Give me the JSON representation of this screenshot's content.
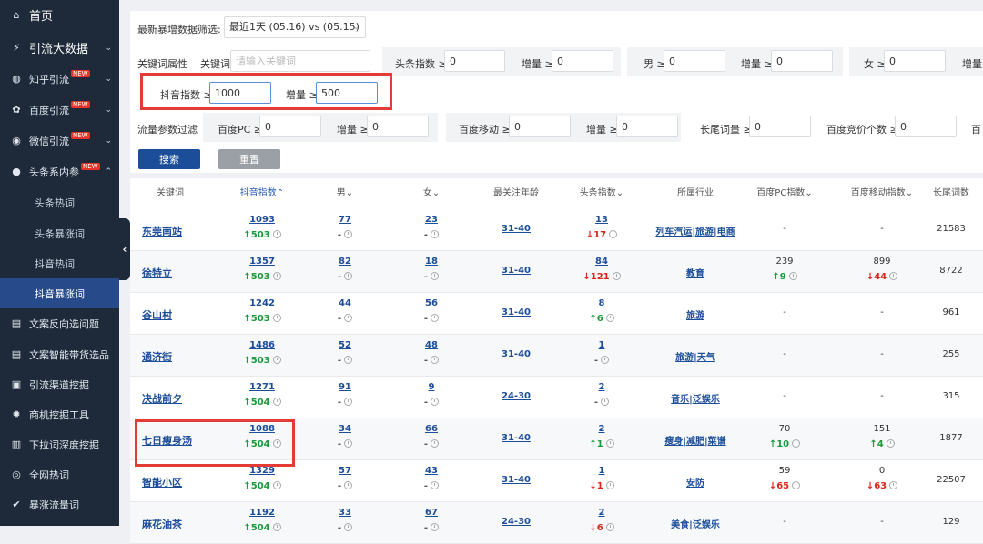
{
  "sidebar": {
    "items": [
      {
        "label": "首页",
        "icon": "home-icon",
        "glyph": "⌂"
      },
      {
        "label": "引流大数据",
        "icon": "pulse-icon",
        "glyph": "⚡"
      },
      {
        "label": "知乎引流",
        "icon": "zhihu-icon",
        "glyph": "◍",
        "badge": "NEW"
      },
      {
        "label": "百度引流",
        "icon": "paw-icon",
        "glyph": "✿",
        "badge": "NEW"
      },
      {
        "label": "微信引流",
        "icon": "wechat-icon",
        "glyph": "◉",
        "badge": "NEW"
      },
      {
        "label": "头条系内参",
        "icon": "chat-icon",
        "glyph": "●",
        "badge": "NEW"
      },
      {
        "label": "头条热词"
      },
      {
        "label": "头条暴涨词"
      },
      {
        "label": "抖音热词"
      },
      {
        "label": "抖音暴涨词"
      },
      {
        "label": "文案反向选问题",
        "icon": "doc-icon",
        "glyph": "▤"
      },
      {
        "label": "文案智能带货选品",
        "icon": "doc-icon",
        "glyph": "▤"
      },
      {
        "label": "引流渠道挖掘",
        "icon": "board-icon",
        "glyph": "▣"
      },
      {
        "label": "商机挖掘工具",
        "icon": "gear-icon",
        "glyph": "✹"
      },
      {
        "label": "下拉词深度挖掘",
        "icon": "dropdown-icon",
        "glyph": "▥"
      },
      {
        "label": "全网热词",
        "icon": "globe-icon",
        "glyph": "◎"
      },
      {
        "label": "暴涨流量词",
        "icon": "check-icon",
        "glyph": "✔"
      }
    ],
    "collapse_glyph": "‹"
  },
  "filters": {
    "date_label": "最新暴增数据筛选:",
    "date_value": "最近1天 (05.16) vs (05.15)",
    "kw_attr_label": "关键词属性",
    "kw_label": "关键词",
    "kw_placeholder": "请输入关键词",
    "toutiao_label": "头条指数 ≥",
    "toutiao_value": "0",
    "inc1_label": "增量 ≥",
    "inc1_value": "0",
    "male_label": "男 ≥",
    "male_value": "0",
    "inc2_label": "增量 ≥",
    "inc2_value": "0",
    "female_label": "女 ≥",
    "female_value": "0",
    "inc3_label": "增量",
    "douyin_label": "抖音指数 ≥",
    "douyin_value": "1000",
    "douyin_inc_label": "增量 ≥",
    "douyin_inc_value": "500",
    "flow_label": "流量参数过滤",
    "baidu_pc_label": "百度PC ≥",
    "baidu_pc_value": "0",
    "inc4_label": "增量 ≥",
    "inc4_value": "0",
    "baidu_mobile_label": "百度移动 ≥",
    "baidu_mobile_value": "0",
    "inc5_label": "增量 ≥",
    "inc5_value": "0",
    "longtail_label": "长尾词量 ≥",
    "longtail_value": "0",
    "bid_label": "百度竞价个数 ≥",
    "bid_value": "0",
    "trailing_label": "百",
    "search_btn": "搜索",
    "reset_btn": "重置"
  },
  "table": {
    "headers": [
      "关键词",
      "抖音指数⌃",
      "男⌄",
      "女⌄",
      "最关注年龄",
      "头条指数⌄",
      "所属行业",
      "百度PC指数⌄",
      "百度移动指数⌄",
      "长尾词数"
    ],
    "rows": [
      {
        "kw": "东莞南站",
        "dy": "1093",
        "dy_d": "↑503",
        "male": "77",
        "male_d": "-",
        "female": "23",
        "female_d": "-",
        "age": "31-40",
        "tt": "13",
        "tt_d": "↓17",
        "ind": "列车汽运|旅游|电商",
        "pc": "-",
        "pc_d": "",
        "mob": "-",
        "mob_d": "",
        "lt": "21583"
      },
      {
        "kw": "徐特立",
        "dy": "1357",
        "dy_d": "↑503",
        "male": "82",
        "male_d": "-",
        "female": "18",
        "female_d": "-",
        "age": "31-40",
        "tt": "84",
        "tt_d": "↓121",
        "ind": "教育",
        "pc": "239",
        "pc_d": "↑9",
        "mob": "899",
        "mob_d": "↓44",
        "lt": "8722"
      },
      {
        "kw": "谷山村",
        "dy": "1242",
        "dy_d": "↑503",
        "male": "44",
        "male_d": "-",
        "female": "56",
        "female_d": "-",
        "age": "31-40",
        "tt": "8",
        "tt_d": "↑6",
        "ind": "旅游",
        "pc": "-",
        "pc_d": "",
        "mob": "-",
        "mob_d": "",
        "lt": "961"
      },
      {
        "kw": "通济街",
        "dy": "1486",
        "dy_d": "↑503",
        "male": "52",
        "male_d": "-",
        "female": "48",
        "female_d": "-",
        "age": "31-40",
        "tt": "1",
        "tt_d": "-",
        "ind": "旅游|天气",
        "pc": "-",
        "pc_d": "",
        "mob": "-",
        "mob_d": "",
        "lt": "255"
      },
      {
        "kw": "决战前夕",
        "dy": "1271",
        "dy_d": "↑504",
        "male": "91",
        "male_d": "-",
        "female": "9",
        "female_d": "-",
        "age": "24-30",
        "tt": "2",
        "tt_d": "-",
        "ind": "音乐|泛娱乐",
        "pc": "-",
        "pc_d": "",
        "mob": "-",
        "mob_d": "",
        "lt": "315"
      },
      {
        "kw": "七日瘦身汤",
        "dy": "1088",
        "dy_d": "↑504",
        "male": "34",
        "male_d": "-",
        "female": "66",
        "female_d": "-",
        "age": "31-40",
        "tt": "2",
        "tt_d": "↑1",
        "ind": "瘦身|减肥|菜谱",
        "pc": "70",
        "pc_d": "↑10",
        "mob": "151",
        "mob_d": "↑4",
        "lt": "1877"
      },
      {
        "kw": "智能小区",
        "dy": "1329",
        "dy_d": "↑504",
        "male": "57",
        "male_d": "-",
        "female": "43",
        "female_d": "-",
        "age": "31-40",
        "tt": "1",
        "tt_d": "↓1",
        "ind": "安防",
        "pc": "59",
        "pc_d": "↓65",
        "mob": "0",
        "mob_d": "↓63",
        "lt": "22507"
      },
      {
        "kw": "麻花油茶",
        "dy": "1192",
        "dy_d": "↑504",
        "male": "33",
        "male_d": "-",
        "female": "67",
        "female_d": "-",
        "age": "24-30",
        "tt": "2",
        "tt_d": "↓6",
        "ind": "美食|泛娱乐",
        "pc": "-",
        "pc_d": "",
        "mob": "-",
        "mob_d": "",
        "lt": "129"
      }
    ]
  },
  "colors": {
    "sidebar_bg": "#1e2a3a",
    "active": "#274a8a",
    "link": "#1c4d99",
    "up": "#1a9a3b",
    "down": "#d9261c",
    "highlight": "#e33b35"
  }
}
